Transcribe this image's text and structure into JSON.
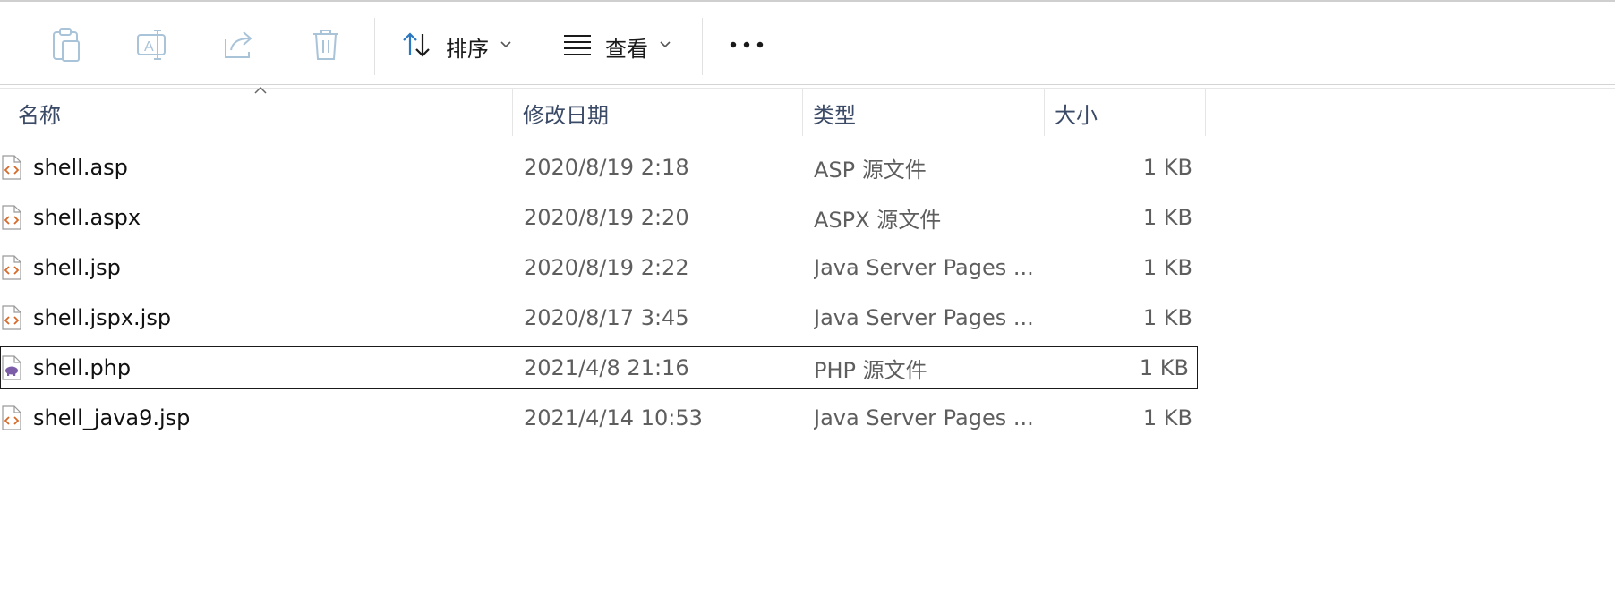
{
  "toolbar": {
    "sort_label": "排序",
    "view_label": "查看",
    "more_label": "•••"
  },
  "columns": {
    "name": "名称",
    "date": "修改日期",
    "type": "类型",
    "size": "大小"
  },
  "files": [
    {
      "name": "shell.asp",
      "date": "2020/8/19 2:18",
      "type": "ASP 源文件",
      "size": "1 KB",
      "icon": "code-file-icon"
    },
    {
      "name": "shell.aspx",
      "date": "2020/8/19 2:20",
      "type": "ASPX 源文件",
      "size": "1 KB",
      "icon": "code-file-icon"
    },
    {
      "name": "shell.jsp",
      "date": "2020/8/19 2:22",
      "type": "Java Server Pages ...",
      "size": "1 KB",
      "icon": "code-file-icon"
    },
    {
      "name": "shell.jspx.jsp",
      "date": "2020/8/17 3:45",
      "type": "Java Server Pages ...",
      "size": "1 KB",
      "icon": "code-file-icon"
    },
    {
      "name": "shell.php",
      "date": "2021/4/8 21:16",
      "type": "PHP 源文件",
      "size": "1 KB",
      "icon": "php-file-icon",
      "selected": true
    },
    {
      "name": "shell_java9.jsp",
      "date": "2021/4/14 10:53",
      "type": "Java Server Pages ...",
      "size": "1 KB",
      "icon": "code-file-icon"
    }
  ],
  "colors": {
    "code_icon": "#d66a2a",
    "php_icon": "#7b5ea7",
    "header_text": "#3b4a66",
    "disabled_icon": "#a9c3d9",
    "accent": "#2b78c2"
  }
}
